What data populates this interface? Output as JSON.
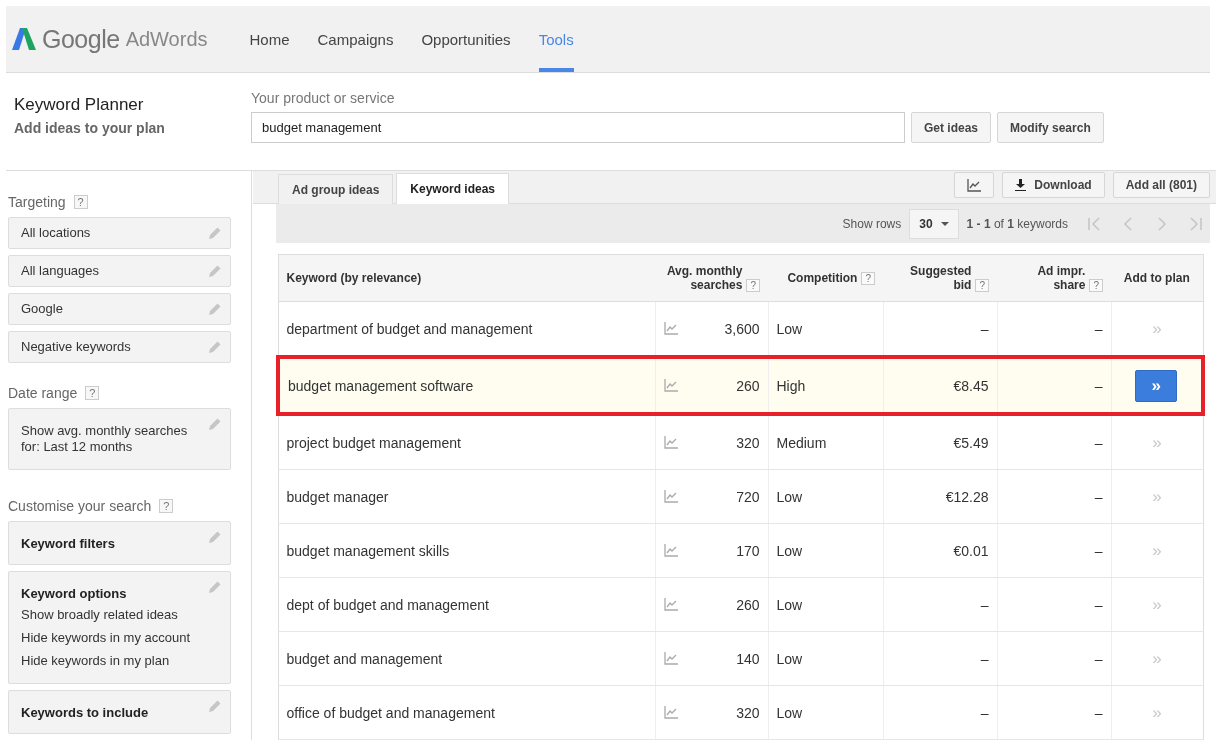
{
  "header": {
    "brand": "Google",
    "product": "AdWords",
    "nav": [
      {
        "label": "Home",
        "selected": false
      },
      {
        "label": "Campaigns",
        "selected": false
      },
      {
        "label": "Opportunities",
        "selected": false
      },
      {
        "label": "Tools",
        "selected": true
      }
    ]
  },
  "planner": {
    "title": "Keyword Planner",
    "subtitle": "Add ideas to your plan",
    "field_label": "Your product or service",
    "value": "budget management",
    "buttons": [
      "Get ideas",
      "Modify search"
    ]
  },
  "sidebar": {
    "sections": [
      {
        "title": "Targeting",
        "help": "?",
        "items": [
          {
            "lines": [
              "All locations"
            ],
            "kind": "plain"
          },
          {
            "lines": [
              "All languages"
            ],
            "kind": "plain"
          },
          {
            "lines": [
              "Google"
            ],
            "kind": "plain"
          },
          {
            "lines": [
              "Negative keywords"
            ],
            "kind": "plain"
          }
        ]
      },
      {
        "title": "Date range",
        "help": "?",
        "items": [
          {
            "lines": [
              "Show avg. monthly searches for: Last 12 months"
            ],
            "kind": "plain"
          }
        ]
      },
      {
        "title": "Customise your search",
        "help": "?",
        "items": [
          {
            "lines": [
              "Keyword filters"
            ],
            "kind": "titled"
          },
          {
            "lines": [
              "Keyword options",
              "Show broadly related ideas",
              "Hide keywords in my account",
              "Hide keywords in my plan"
            ],
            "kind": "titled"
          },
          {
            "lines": [
              "Keywords to include"
            ],
            "kind": "titled"
          }
        ]
      }
    ]
  },
  "results": {
    "tabs": [
      {
        "label": "Ad group ideas",
        "selected": false
      },
      {
        "label": "Keyword ideas",
        "selected": true
      }
    ],
    "download": "Download",
    "add_all": "Add all (801)",
    "show_rows_label": "Show rows",
    "rows_value": "30",
    "range": "**1 - 1** of **1** keywords",
    "columns": [
      {
        "label": "Keyword (by relevance)"
      },
      {
        "label": "Avg. monthly searches",
        "help": "?"
      },
      {
        "label": "Competition",
        "help": "?"
      },
      {
        "label": "Suggested bid",
        "help": "?"
      },
      {
        "label": "Ad impr. share",
        "help": "?"
      },
      {
        "label": "Add to plan"
      }
    ],
    "rows": [
      {
        "keyword": "department of budget and management",
        "searches": "3,600",
        "competition": "Low",
        "bid": "–",
        "share": "–",
        "add": "»",
        "highlighted": false
      },
      {
        "keyword": "budget management software",
        "searches": "260",
        "competition": "High",
        "bid": "€8.45",
        "share": "–",
        "add": "»",
        "highlighted": true
      },
      {
        "keyword": "project budget management",
        "searches": "320",
        "competition": "Medium",
        "bid": "€5.49",
        "share": "–",
        "add": "»",
        "highlighted": false
      },
      {
        "keyword": "budget manager",
        "searches": "720",
        "competition": "Low",
        "bid": "€12.28",
        "share": "–",
        "add": "»",
        "highlighted": false
      },
      {
        "keyword": "budget management skills",
        "searches": "170",
        "competition": "Low",
        "bid": "€0.01",
        "share": "–",
        "add": "»",
        "highlighted": false
      },
      {
        "keyword": "dept of budget and management",
        "searches": "260",
        "competition": "Low",
        "bid": "–",
        "share": "–",
        "add": "»",
        "highlighted": false
      },
      {
        "keyword": "budget and management",
        "searches": "140",
        "competition": "Low",
        "bid": "–",
        "share": "–",
        "add": "»",
        "highlighted": false
      },
      {
        "keyword": "office of budget and management",
        "searches": "320",
        "competition": "Low",
        "bid": "–",
        "share": "–",
        "add": "»",
        "highlighted": false
      }
    ]
  }
}
